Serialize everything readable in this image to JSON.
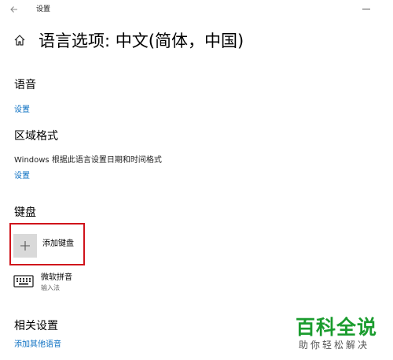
{
  "window": {
    "title": "设置"
  },
  "header": {
    "title": "语言选项: 中文(简体，中国)"
  },
  "sections": {
    "language": {
      "heading": "语音",
      "settings_link": "设置"
    },
    "region": {
      "heading": "区域格式",
      "description": "Windows 根据此语言设置日期和时间格式",
      "settings_link": "设置"
    },
    "keyboard": {
      "heading": "键盘",
      "add_label": "添加键盘",
      "items": [
        {
          "name": "微软拼音",
          "subtitle": "输入法",
          "icon": "keyboard-icon"
        }
      ]
    },
    "related": {
      "heading": "相关设置",
      "link": "添加其他语音"
    }
  },
  "watermark": {
    "main": "百科全说",
    "sub": "助你轻松解决"
  },
  "colors": {
    "link": "#0a6fc2",
    "highlight": "#d0131b",
    "watermark": "#1a9c2e",
    "tile": "#d9d9d9"
  },
  "icons": [
    "back-arrow-icon",
    "minimize-icon",
    "home-icon",
    "plus-icon",
    "keyboard-icon"
  ]
}
